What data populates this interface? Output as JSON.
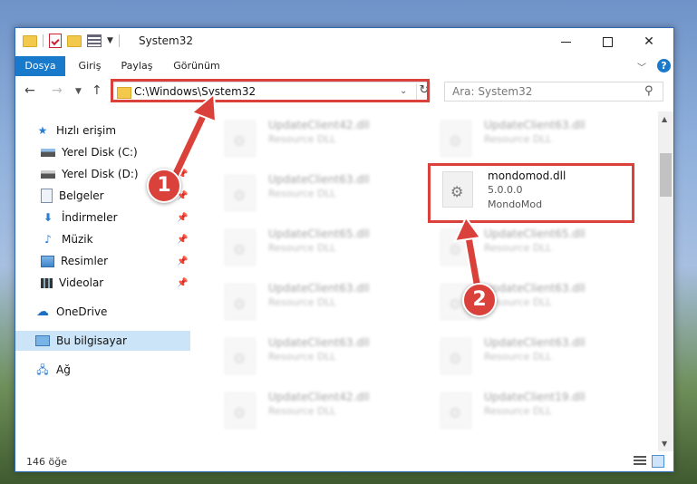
{
  "window": {
    "title": "System32"
  },
  "ribbon": {
    "tabs": [
      {
        "label": "Dosya"
      },
      {
        "label": "Giriş"
      },
      {
        "label": "Paylaş"
      },
      {
        "label": "Görünüm"
      }
    ],
    "help_label": "?"
  },
  "address": {
    "path": "C:\\Windows\\System32"
  },
  "search": {
    "placeholder": "Ara: System32"
  },
  "sidebar": {
    "items": [
      {
        "label": "Hızlı erişim",
        "icon": "star-icon"
      },
      {
        "label": "Yerel Disk (C:)",
        "icon": "drive-icon",
        "pinned": true
      },
      {
        "label": "Yerel Disk (D:)",
        "icon": "drive-icon",
        "pinned": true
      },
      {
        "label": "Belgeler",
        "icon": "documents-icon",
        "pinned": true
      },
      {
        "label": "İndirmeler",
        "icon": "download-icon",
        "pinned": true
      },
      {
        "label": "Müzik",
        "icon": "music-icon",
        "pinned": true
      },
      {
        "label": "Resimler",
        "icon": "pictures-icon",
        "pinned": true
      },
      {
        "label": "Videolar",
        "icon": "videos-icon",
        "pinned": true
      },
      {
        "label": "OneDrive",
        "icon": "cloud-icon"
      },
      {
        "label": "Bu bilgisayar",
        "icon": "computer-icon",
        "selected": true
      },
      {
        "label": "Ağ",
        "icon": "network-icon"
      }
    ]
  },
  "files": {
    "left": [
      {
        "name": "UpdateClient42.dll",
        "type": "Resource DLL"
      },
      {
        "name": "UpdateClient63.dll",
        "type": "Resource DLL"
      },
      {
        "name": "UpdateClient65.dll",
        "type": "Resource DLL"
      },
      {
        "name": "UpdateClient63.dll",
        "type": "Resource DLL"
      },
      {
        "name": "UpdateClient63.dll",
        "type": "Resource DLL"
      },
      {
        "name": "UpdateClient42.dll",
        "type": "Resource DLL"
      }
    ],
    "right": [
      {
        "name": "UpdateClient63.dll",
        "type": "Resource DLL"
      },
      {
        "name": "mondomod.dll",
        "version": "5.0.0.0",
        "type": "MondoMod",
        "highlighted": true
      },
      {
        "name": "UpdateClient65.dll",
        "type": "Resource DLL"
      },
      {
        "name": "UpdateClient63.dll",
        "type": "Resource DLL"
      },
      {
        "name": "UpdateClient63.dll",
        "type": "Resource DLL"
      },
      {
        "name": "UpdateClient19.dll",
        "type": "Resource DLL"
      }
    ]
  },
  "status": {
    "count": "146 öğe"
  },
  "callouts": [
    {
      "label": "1"
    },
    {
      "label": "2"
    }
  ],
  "colors": {
    "accent": "#1979ca",
    "highlight": "#d9413a",
    "selection": "#cce4f7"
  }
}
